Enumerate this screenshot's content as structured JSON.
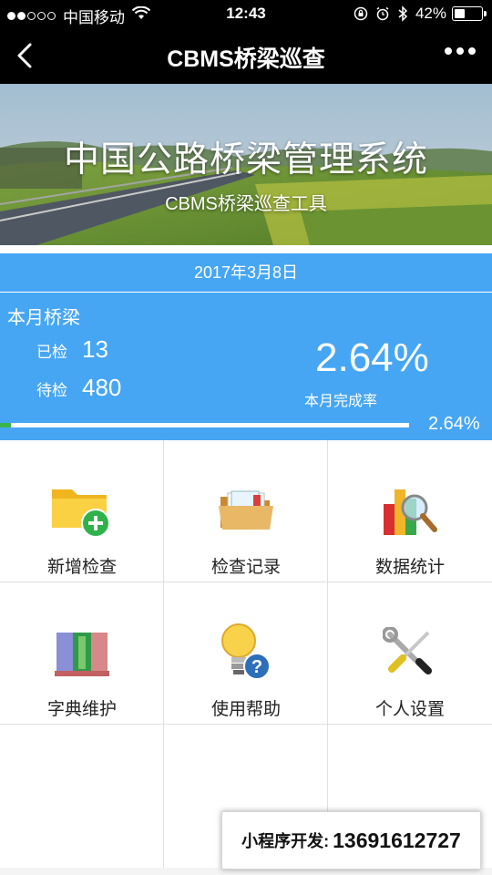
{
  "status_bar": {
    "carrier": "中国移动",
    "time": "12:43",
    "battery": "42%",
    "battery_level": 0.42
  },
  "nav": {
    "title": "CBMS桥梁巡查"
  },
  "banner": {
    "title": "中国公路桥梁管理系统",
    "subtitle": "CBMS桥梁巡查工具"
  },
  "stats": {
    "date": "2017年3月8日",
    "heading": "本月桥梁",
    "checked_label": "已检",
    "checked_value": "13",
    "pending_label": "待检",
    "pending_value": "480",
    "completion_percent": "2.64%",
    "completion_label": "本月完成率",
    "progress_label": "2.64%",
    "progress_fraction": 0.0264
  },
  "menu": {
    "items": [
      {
        "label": "新增检查",
        "icon": "folder-add-icon"
      },
      {
        "label": "检查记录",
        "icon": "records-folder-icon"
      },
      {
        "label": "数据统计",
        "icon": "chart-magnifier-icon"
      },
      {
        "label": "字典维护",
        "icon": "books-icon"
      },
      {
        "label": "使用帮助",
        "icon": "lightbulb-help-icon"
      },
      {
        "label": "个人设置",
        "icon": "tools-icon"
      }
    ]
  },
  "developer": {
    "label": "小程序开发:",
    "phone": "13691612727"
  },
  "colors": {
    "nav_bg": "#000000",
    "stats_bg": "#46a6f3",
    "progress_fill": "#39b54a"
  }
}
